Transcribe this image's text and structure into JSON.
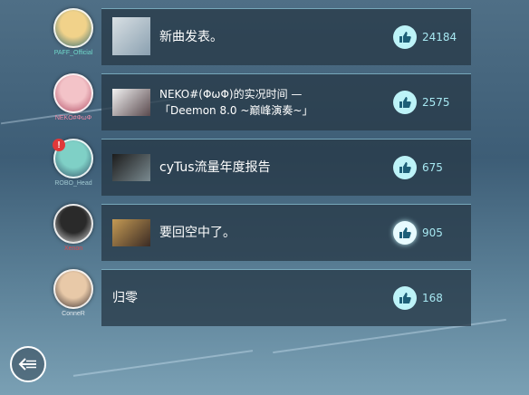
{
  "colors": {
    "card_bg": "#283a48",
    "like_bubble": "#bdf3f8",
    "like_text": "#a7e8f2",
    "accent_line": "#96d2e6",
    "badge": "#e0383a"
  },
  "back_button": {
    "icon": "back-arrow-icon"
  },
  "posts": [
    {
      "username": "PAFF_Official",
      "username_color": "#6fd6c8",
      "avatar_colors": [
        "#f1d28a",
        "#2f6a73"
      ],
      "message_lines": [
        "新曲发表。"
      ],
      "has_thumbnail": true,
      "thumbnail_colors": [
        "#d9e0e4",
        "#8aa0b0"
      ],
      "likes": "24184",
      "liked": false,
      "badge": ""
    },
    {
      "username": "NEKO#ΦωΦ",
      "username_color": "#f08aa8",
      "avatar_colors": [
        "#f3c3c8",
        "#b14a62"
      ],
      "message_lines": [
        "NEKO#(ΦωΦ)的实况时间 —",
        "「Deemon 8.0 ~巅峰演奏~」"
      ],
      "has_thumbnail": true,
      "thumbnail_colors": [
        "#f2f2f2",
        "#5a4a4e"
      ],
      "likes": "2575",
      "liked": false,
      "badge": ""
    },
    {
      "username": "ROBO_Head",
      "username_color": "#9fc7cf",
      "avatar_colors": [
        "#7fd0c6",
        "#34556a"
      ],
      "message_lines": [
        "cyTus流量年度报告"
      ],
      "has_thumbnail": true,
      "thumbnail_colors": [
        "#1c1c1c",
        "#7a8a90"
      ],
      "likes": "675",
      "liked": false,
      "badge": "!"
    },
    {
      "username": "Xenon",
      "username_color": "#e0474a",
      "avatar_colors": [
        "#2a2a2a",
        "#d7d7d7"
      ],
      "message_lines": [
        "要回空中了。"
      ],
      "has_thumbnail": true,
      "thumbnail_colors": [
        "#c49a54",
        "#3b2b24"
      ],
      "likes": "905",
      "liked": true,
      "badge": ""
    },
    {
      "username": "ConneR",
      "username_color": "#dfe6ea",
      "avatar_colors": [
        "#e8c9a8",
        "#3b3030"
      ],
      "message_lines": [
        "归零"
      ],
      "has_thumbnail": false,
      "thumbnail_colors": [
        "",
        ""
      ],
      "likes": "168",
      "liked": false,
      "badge": ""
    }
  ]
}
